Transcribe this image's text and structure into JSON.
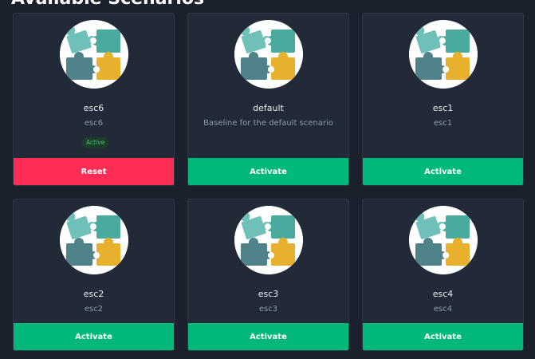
{
  "section": {
    "title": "Available Scenarios"
  },
  "colors": {
    "background": "#1a202c",
    "card": "#232a37",
    "reset_button": "#ff2d55",
    "activate_button": "#00b87a",
    "active_badge_text": "#3fc06f",
    "puzzle_teal_light": "#6ec0b8",
    "puzzle_teal": "#4aaa9e",
    "puzzle_slate": "#4f8389",
    "puzzle_yellow": "#e8b12d"
  },
  "scenarios": [
    {
      "name": "esc6",
      "description": "esc6",
      "badge": "Active",
      "button": "Reset",
      "icon": "puzzle-pieces-icon"
    },
    {
      "name": "default",
      "description": "Baseline for the default scenario",
      "button": "Activate",
      "icon": "puzzle-pieces-icon"
    },
    {
      "name": "esc1",
      "description": "esc1",
      "button": "Activate",
      "icon": "puzzle-pieces-icon"
    },
    {
      "name": "esc2",
      "description": "esc2",
      "button": "Activate",
      "icon": "puzzle-pieces-icon"
    },
    {
      "name": "esc3",
      "description": "esc3",
      "button": "Activate",
      "icon": "puzzle-pieces-icon"
    },
    {
      "name": "esc4",
      "description": "esc4",
      "button": "Activate",
      "icon": "puzzle-pieces-icon"
    }
  ]
}
